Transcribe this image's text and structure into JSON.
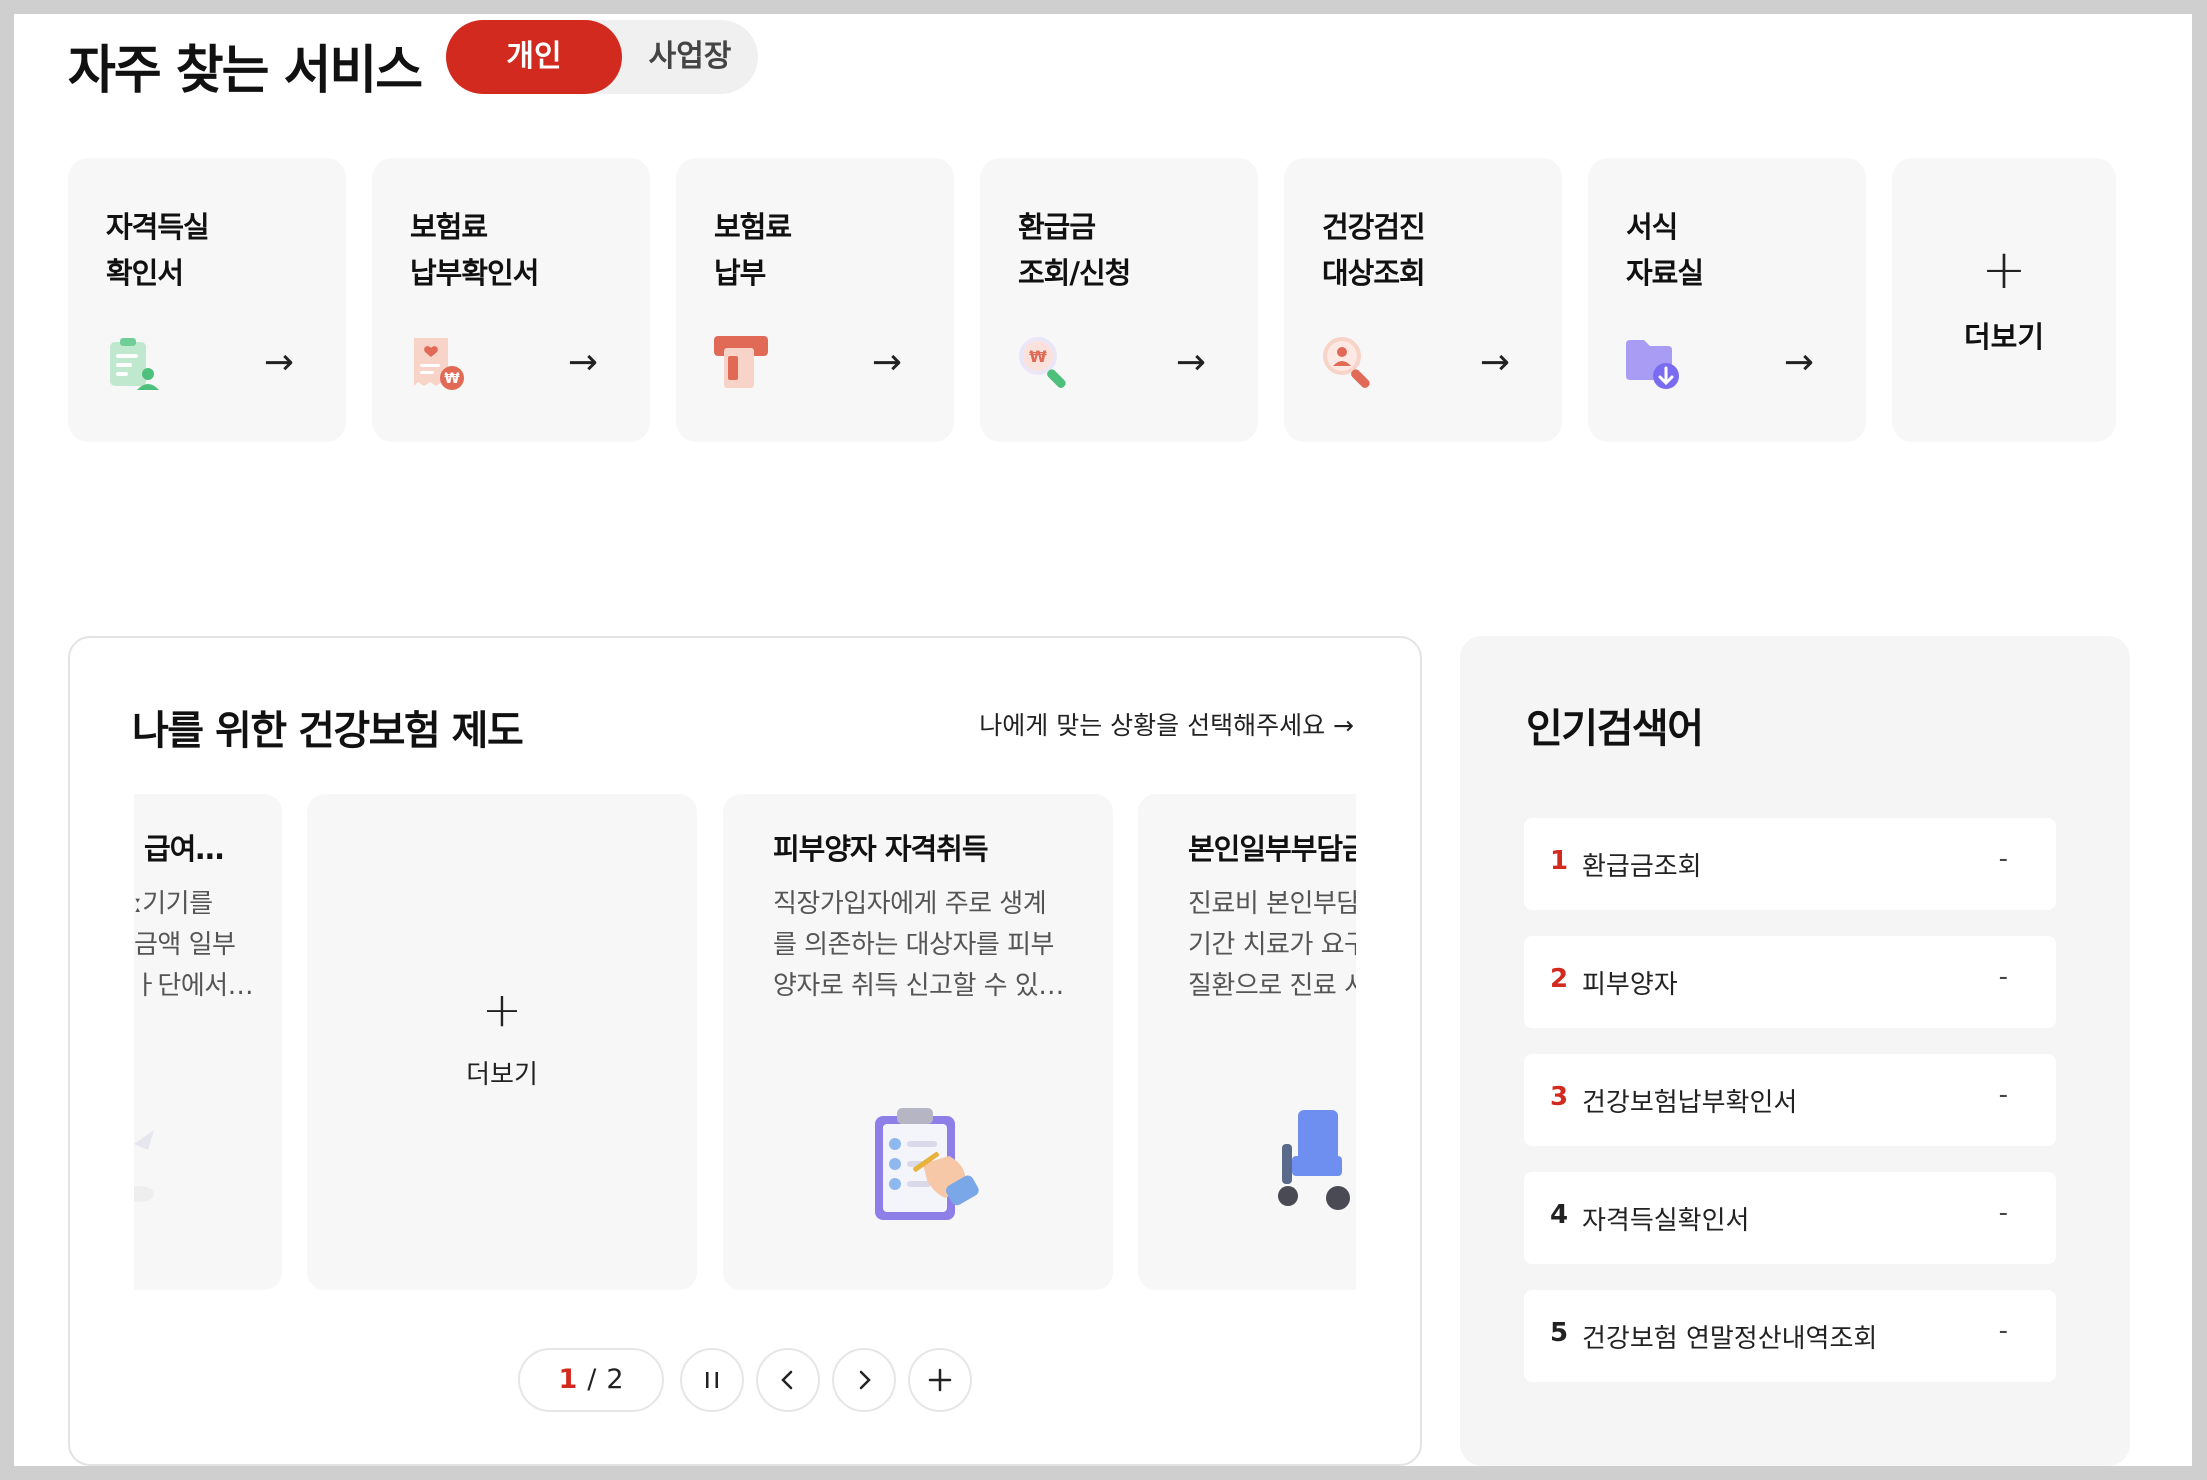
{
  "services": {
    "title": "자주 찾는 서비스",
    "tabs": {
      "personal": "개인",
      "business": "사업장"
    },
    "arrow": "→",
    "cards": [
      {
        "line1": "자격득실",
        "line2": "확인서",
        "icon": "id-card-person-icon"
      },
      {
        "line1": "보험료",
        "line2": "납부확인서",
        "icon": "receipt-won-icon"
      },
      {
        "line1": "보험료",
        "line2": "납부",
        "icon": "card-payment-icon"
      },
      {
        "line1": "환급금",
        "line2": "조회/신청",
        "icon": "magnifier-won-icon"
      },
      {
        "line1": "건강검진",
        "line2": "대상조회",
        "icon": "magnifier-person-icon"
      },
      {
        "line1": "서식",
        "line2": "자료실",
        "icon": "folder-download-icon"
      }
    ],
    "more": {
      "plus": "+",
      "label": "더보기"
    },
    "colors": {
      "accent": "#d32a20",
      "green": "#4fbf7c",
      "coral": "#e06a56",
      "purple": "#7a6cf0"
    }
  },
  "system": {
    "title": "나를 위한 건강보험 제도",
    "link": "나에게 맞는 상황을 선택해주세요 →",
    "slides": [
      {
        "title": "급여…",
        "desc_lines": [
          "ː기기를",
          "금액 일부",
          "ㅏ단에서…"
        ]
      },
      {
        "more_plus": "+",
        "more_label": "더보기"
      },
      {
        "title": "피부양자 자격취득",
        "desc_lines": [
          "직장가입자에게 주로 생계",
          "를 의존하는 대상자를 피부",
          "양자로 취득 신고할 수 있…"
        ]
      },
      {
        "title": "본인일부부담금",
        "desc_lines": [
          "진료비 본인부담",
          "기간 치료가 요구",
          "질환으로 진료 시"
        ]
      }
    ],
    "pager": {
      "current": "1",
      "separator": "/",
      "total": "2"
    }
  },
  "popular": {
    "title": "인기검색어",
    "items": [
      {
        "rank": "1",
        "term": "환급금조회",
        "change": "-"
      },
      {
        "rank": "2",
        "term": "피부양자",
        "change": "-"
      },
      {
        "rank": "3",
        "term": "건강보험납부확인서",
        "change": "-"
      },
      {
        "rank": "4",
        "term": "자격득실확인서",
        "change": "-"
      },
      {
        "rank": "5",
        "term": "건강보험 연말정산내역조회",
        "change": "-"
      }
    ]
  }
}
